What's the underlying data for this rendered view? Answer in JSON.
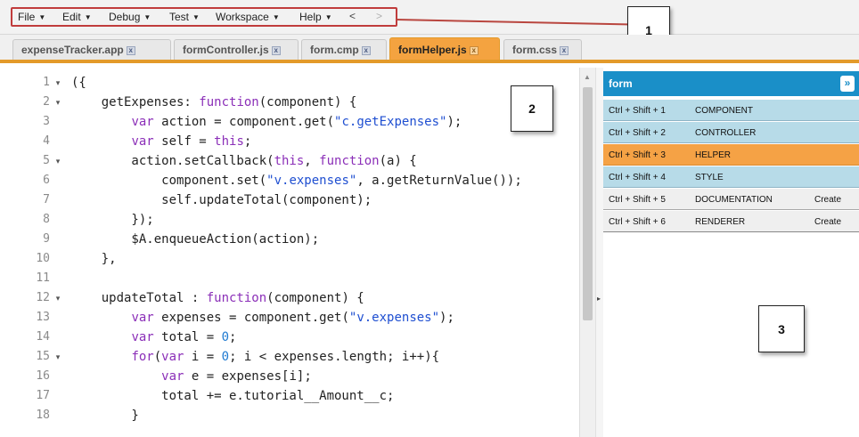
{
  "menu": {
    "items": [
      {
        "label": "File"
      },
      {
        "label": "Edit"
      },
      {
        "label": "Debug"
      },
      {
        "label": "Test"
      },
      {
        "label": "Workspace"
      },
      {
        "label": "Help"
      }
    ],
    "back_arrow": "<",
    "forward_arrow": ">"
  },
  "callouts": {
    "one": "1",
    "two": "2",
    "three": "3"
  },
  "tabs": [
    {
      "label": "expenseTracker.app",
      "active": false
    },
    {
      "label": "formController.js",
      "active": false
    },
    {
      "label": "form.cmp",
      "active": false
    },
    {
      "label": "formHelper.js",
      "active": true
    },
    {
      "label": "form.css",
      "active": false
    }
  ],
  "editor": {
    "line_numbers": [
      "1",
      "2",
      "3",
      "4",
      "5",
      "6",
      "7",
      "8",
      "9",
      "10",
      "11",
      "12",
      "13",
      "14",
      "15",
      "16",
      "17",
      "18"
    ],
    "fold_markers": [
      "▾",
      "▾",
      "",
      "",
      "▾",
      "",
      "",
      "",
      "",
      "",
      "",
      "▾",
      "",
      "",
      "▾",
      "",
      "",
      ""
    ],
    "lines": [
      "({",
      "    getExpenses: function(component) {",
      "        var action = component.get(\"c.getExpenses\");",
      "        var self = this;",
      "        action.setCallback(this, function(a) {",
      "            component.set(\"v.expenses\", a.getReturnValue());",
      "            self.updateTotal(component);",
      "        });",
      "        $A.enqueueAction(action);",
      "    },",
      "",
      "    updateTotal : function(component) {",
      "        var expenses = component.get(\"v.expenses\");",
      "        var total = 0;",
      "        for(var i = 0; i < expenses.length; i++){",
      "            var e = expenses[i];",
      "            total += e.tutorial__Amount__c;",
      "        }"
    ]
  },
  "panel": {
    "title": "form",
    "collapse_icon": "»",
    "rows": [
      {
        "shortcut": "Ctrl + Shift + 1",
        "name": "COMPONENT",
        "action": "",
        "state": "blue"
      },
      {
        "shortcut": "Ctrl + Shift + 2",
        "name": "CONTROLLER",
        "action": "",
        "state": "blue"
      },
      {
        "shortcut": "Ctrl + Shift + 3",
        "name": "HELPER",
        "action": "",
        "state": "orange"
      },
      {
        "shortcut": "Ctrl + Shift + 4",
        "name": "STYLE",
        "action": "",
        "state": "blue"
      },
      {
        "shortcut": "Ctrl + Shift + 5",
        "name": "DOCUMENTATION",
        "action": "Create",
        "state": "gray"
      },
      {
        "shortcut": "Ctrl + Shift + 6",
        "name": "RENDERER",
        "action": "Create",
        "state": "gray"
      }
    ]
  },
  "colors": {
    "accent_orange": "#f5a245",
    "panel_blue": "#1a8fc8",
    "row_blue": "#b7dbe8",
    "callout_line_red": "#c03c3c"
  }
}
